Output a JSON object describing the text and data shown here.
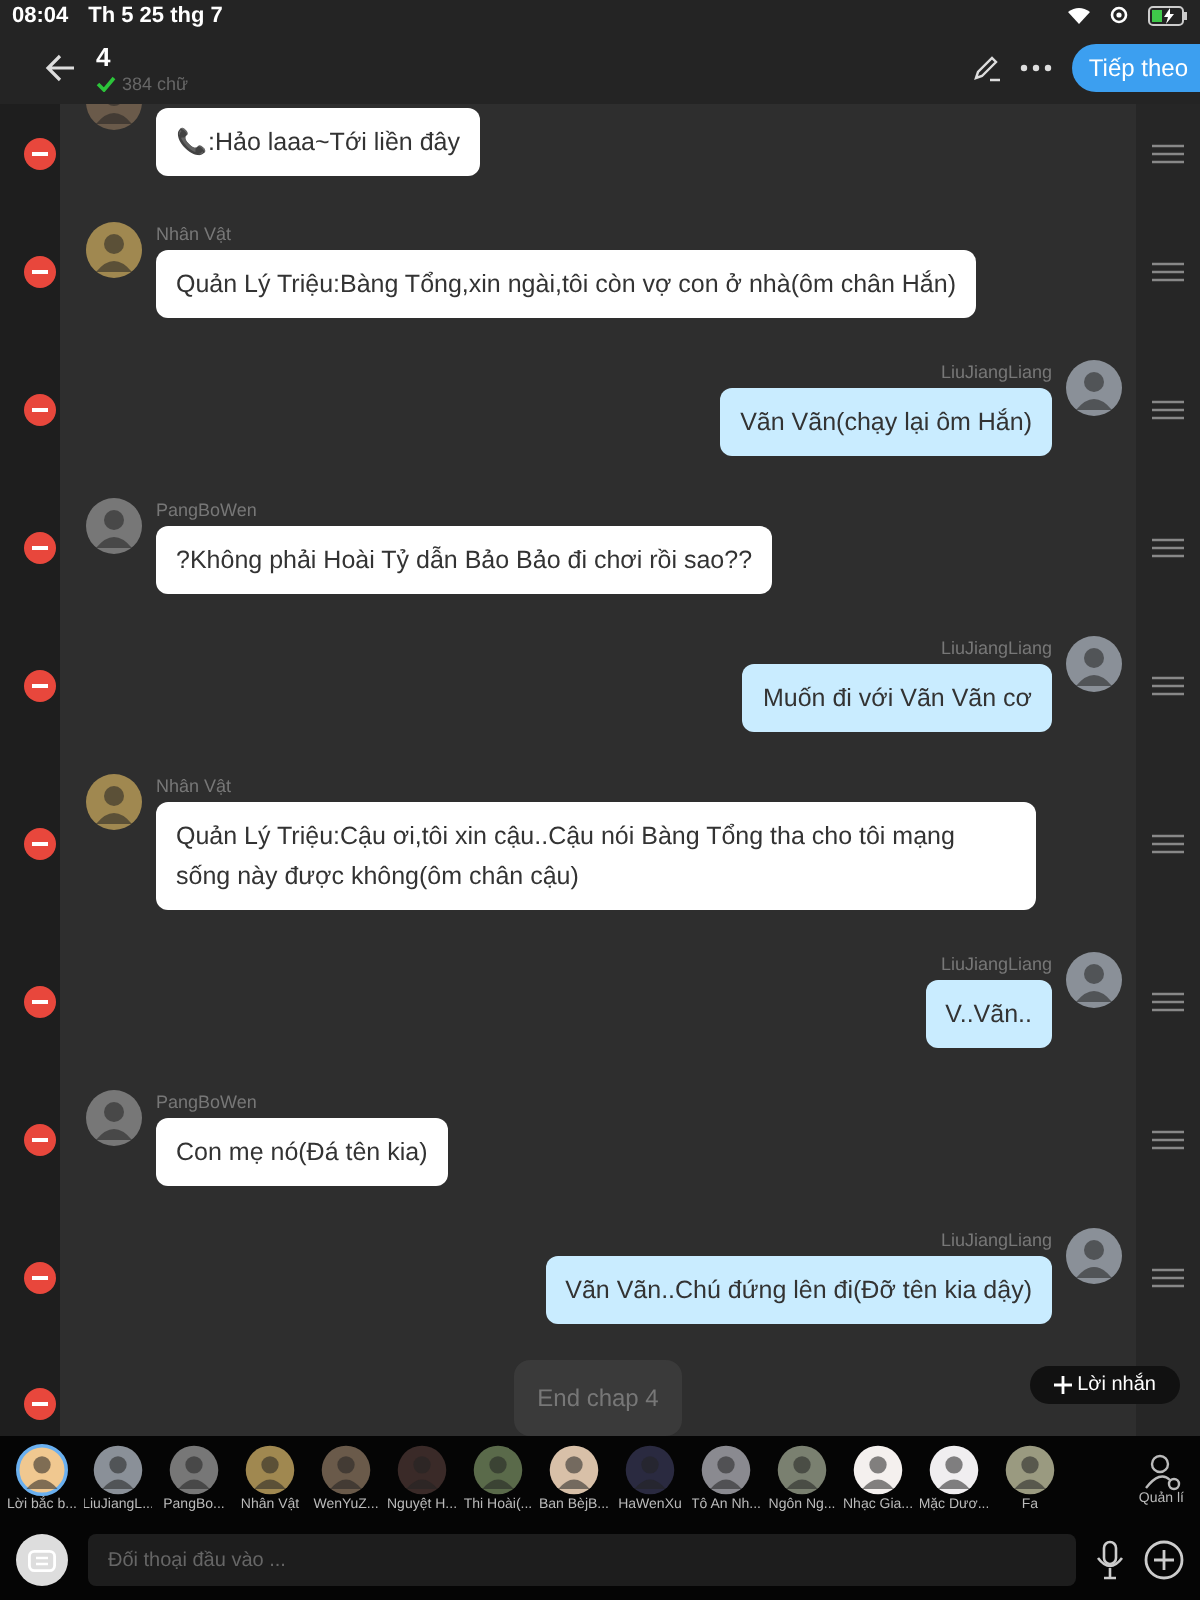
{
  "status_bar": {
    "time": "08:04",
    "date": "Th 5 25 thg 7"
  },
  "header": {
    "title": "4",
    "word_count": "384 chữ",
    "next_button": "Tiếp theo"
  },
  "messages": [
    {
      "kind": "message",
      "outgoing": false,
      "text": "📞:Hảo laaa~Tới liền đây",
      "color": "#6a5a4a"
    },
    {
      "kind": "message",
      "outgoing": false,
      "name": "Nhân Vật",
      "text": "Quản Lý Triệu:Bàng Tổng,xin ngài,tôi còn vợ con ở nhà(ôm chân Hắn)",
      "color": "#a08850"
    },
    {
      "kind": "message",
      "outgoing": true,
      "name": "LiuJiangLiang",
      "text": "Vãn Vãn(chạy lại ôm Hắn)",
      "color": "#8a9098"
    },
    {
      "kind": "message",
      "outgoing": false,
      "name": "PangBoWen",
      "text": "?Không phải Hoài Tỷ dẫn Bảo Bảo đi chơi rồi sao??",
      "color": "#777777"
    },
    {
      "kind": "message",
      "outgoing": true,
      "name": "LiuJiangLiang",
      "text": "Muốn đi với Vãn Vãn cơ",
      "color": "#8a9098"
    },
    {
      "kind": "message",
      "outgoing": false,
      "name": "Nhân Vật",
      "text": "Quản Lý Triệu:Cậu ơi,tôi xin cậu..Cậu nói Bàng Tổng tha cho tôi mạng sống này được không(ôm chân cậu)",
      "color": "#a08850"
    },
    {
      "kind": "message",
      "outgoing": true,
      "name": "LiuJiangLiang",
      "text": "V..Vãn..",
      "color": "#8a9098"
    },
    {
      "kind": "message",
      "outgoing": false,
      "name": "PangBoWen",
      "text": "Con mẹ nó(Đá tên kia)",
      "color": "#777777"
    },
    {
      "kind": "message",
      "outgoing": true,
      "name": "LiuJiangLiang",
      "text": "Vãn Vãn..Chú đứng lên đi(Đỡ tên kia dậy)",
      "color": "#8a9098"
    },
    {
      "kind": "system",
      "text": "End chap 4"
    }
  ],
  "note_button": "Lời nhắn",
  "characters": [
    {
      "label": "Lời bắc b...",
      "selected": true,
      "color": "#f0c890"
    },
    {
      "label": "LiuJiangL...",
      "selected": false,
      "color": "#8a9098"
    },
    {
      "label": "PangBo...",
      "selected": false,
      "color": "#777777"
    },
    {
      "label": "Nhân Vật",
      "selected": false,
      "color": "#a08850"
    },
    {
      "label": "WenYuZ...",
      "selected": false,
      "color": "#6a5a4a"
    },
    {
      "label": "Nguyệt H...",
      "selected": false,
      "color": "#3a2a28"
    },
    {
      "label": "Thi Hoài(...",
      "selected": false,
      "color": "#5a6a4a"
    },
    {
      "label": "Ban BèjB...",
      "selected": false,
      "color": "#d8c0a8"
    },
    {
      "label": "HaWenXu",
      "selected": false,
      "color": "#2a2a40"
    },
    {
      "label": "Tô An Nh...",
      "selected": false,
      "color": "#8a8a90"
    },
    {
      "label": "Ngôn Ng...",
      "selected": false,
      "color": "#7a8070"
    },
    {
      "label": "Nhạc Gia...",
      "selected": false,
      "color": "#f4f0ee"
    },
    {
      "label": "Mặc Dươ...",
      "selected": false,
      "color": "#f0eef0"
    },
    {
      "label": "Fa",
      "selected": false,
      "color": "#9a9a80"
    }
  ],
  "manage_label": "Quản lí",
  "input": {
    "placeholder": "Đối thoại đầu vào ..."
  }
}
